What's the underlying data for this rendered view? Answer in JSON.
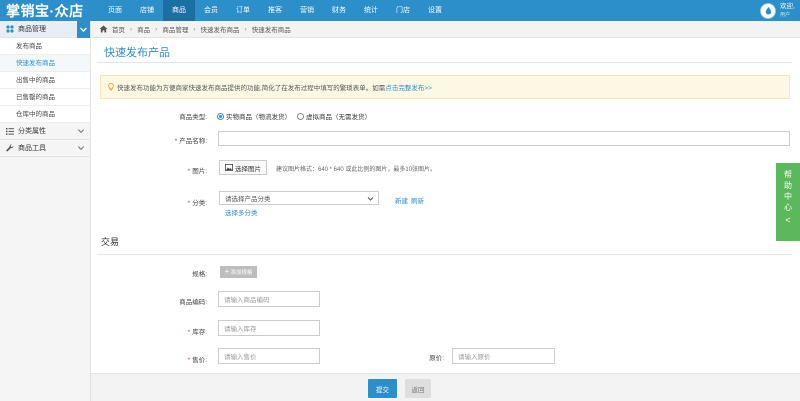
{
  "header": {
    "logo": "掌销宝·众店",
    "nav": [
      "页面",
      "店铺",
      "商品",
      "会员",
      "订单",
      "推客",
      "营销",
      "财务",
      "统计",
      "门店",
      "设置"
    ],
    "active_nav": "商品",
    "user_welcome": "欢迎,",
    "user_name": "用户"
  },
  "sidebar": {
    "groups": [
      {
        "label": "商品管理",
        "icon": "grid-icon",
        "open": true,
        "items": [
          "发布商品",
          "快速发布商品",
          "出售中的商品",
          "已售罄的商品",
          "仓库中的商品"
        ],
        "active_item": "快速发布商品"
      },
      {
        "label": "分类属性",
        "icon": "list-icon",
        "open": false
      },
      {
        "label": "商品工具",
        "icon": "wrench-icon",
        "open": false
      }
    ]
  },
  "breadcrumb": [
    "首页",
    "商品",
    "商品管理",
    "快速发布商品",
    "快速发布商品"
  ],
  "page": {
    "title": "快速发布产品",
    "notice_text": "快速发布功能为方便商家快速发布商品提供的功能,简化了在发布过程中填写的繁琐表单。如需",
    "notice_link": "点击完整发布>>"
  },
  "form": {
    "product_type_label": "商品类型:",
    "type_options": [
      "实物商品（物流发货）",
      "虚拟商品（无需发货）"
    ],
    "type_selected": 0,
    "name_label": "产品名称:",
    "name_value": "",
    "image_label": "图片:",
    "image_button": "选择图片",
    "image_hint": "建议图片格式：640 * 640 或此比例的图片，最多10张图片。",
    "category_label": "分类:",
    "category_placeholder": "请选择产品分类",
    "category_new": "新建",
    "category_refresh": "刷新",
    "category_multi": "选择多分类",
    "trade_section": "交易",
    "spec_label": "规格:",
    "spec_button": "添加规格",
    "code_label": "商品编码:",
    "code_placeholder": "请输入商品编码",
    "stock_label": "库存:",
    "stock_placeholder": "请输入库存",
    "price_label": "售价:",
    "price_placeholder": "请输入售价",
    "orig_price_label": "原价:",
    "orig_price_placeholder": "请输入原价"
  },
  "footer": {
    "submit": "提交",
    "back": "返回"
  },
  "help_tab": {
    "chars": [
      "帮",
      "助",
      "中",
      "心"
    ],
    "arrow": "<"
  },
  "colors": {
    "primary": "#2c8fc9",
    "help": "#5cb85c",
    "notice_bg": "#fcf8e3"
  }
}
